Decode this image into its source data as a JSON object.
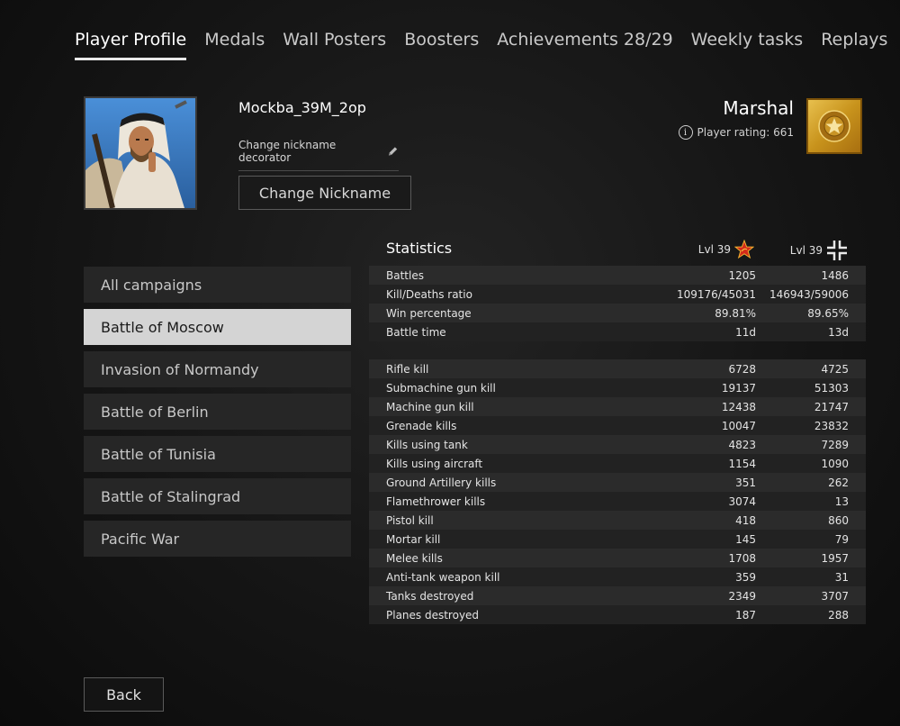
{
  "nav": {
    "tabs": [
      {
        "label": "Player Profile"
      },
      {
        "label": "Medals"
      },
      {
        "label": "Wall Posters"
      },
      {
        "label": "Boosters"
      },
      {
        "label": "Achievements 28/29"
      },
      {
        "label": "Weekly tasks"
      },
      {
        "label": "Replays"
      }
    ],
    "active": 0
  },
  "profile": {
    "nickname": "Mockba_39M_2op",
    "decorator_label": "Change nickname decorator",
    "change_nickname_label": "Change Nickname",
    "rank": "Marshal",
    "rating_label": "Player rating: 661"
  },
  "campaigns": {
    "items": [
      {
        "label": "All campaigns"
      },
      {
        "label": "Battle of Moscow"
      },
      {
        "label": "Invasion of Normandy"
      },
      {
        "label": "Battle of Berlin"
      },
      {
        "label": "Battle of Tunisia"
      },
      {
        "label": "Battle of Stalingrad"
      },
      {
        "label": "Pacific War"
      }
    ],
    "active": 1
  },
  "stats": {
    "title": "Statistics",
    "col1_level": "Lvl 39",
    "col2_level": "Lvl 39",
    "col1_icon": "soviet-star-icon",
    "col2_icon": "balkenkreuz-icon",
    "summary": [
      {
        "label": "Battles",
        "v1": "1205",
        "v2": "1486"
      },
      {
        "label": "Kill/Deaths ratio",
        "v1": "109176/45031",
        "v2": "146943/59006"
      },
      {
        "label": "Win percentage",
        "v1": "89.81%",
        "v2": "89.65%"
      },
      {
        "label": "Battle time",
        "v1": "11d",
        "v2": "13d"
      }
    ],
    "kills": [
      {
        "label": "Rifle kill",
        "v1": "6728",
        "v2": "4725"
      },
      {
        "label": "Submachine gun kill",
        "v1": "19137",
        "v2": "51303"
      },
      {
        "label": "Machine gun kill",
        "v1": "12438",
        "v2": "21747"
      },
      {
        "label": "Grenade kills",
        "v1": "10047",
        "v2": "23832"
      },
      {
        "label": "Kills using tank",
        "v1": "4823",
        "v2": "7289"
      },
      {
        "label": "Kills using aircraft",
        "v1": "1154",
        "v2": "1090"
      },
      {
        "label": "Ground Artillery kills",
        "v1": "351",
        "v2": "262"
      },
      {
        "label": "Flamethrower kills",
        "v1": "3074",
        "v2": "13"
      },
      {
        "label": "Pistol kill",
        "v1": "418",
        "v2": "860"
      },
      {
        "label": "Mortar kill",
        "v1": "145",
        "v2": "79"
      },
      {
        "label": "Melee kills",
        "v1": "1708",
        "v2": "1957"
      },
      {
        "label": "Anti-tank weapon kill",
        "v1": "359",
        "v2": "31"
      },
      {
        "label": "Tanks destroyed",
        "v1": "2349",
        "v2": "3707"
      },
      {
        "label": "Planes destroyed",
        "v1": "187",
        "v2": "288"
      }
    ]
  },
  "footer": {
    "back_label": "Back"
  },
  "colors": {
    "accent_gold": "#d4a22e",
    "soviet_red": "#d42a1a",
    "active_tab_underline": "#e8e8e8"
  }
}
